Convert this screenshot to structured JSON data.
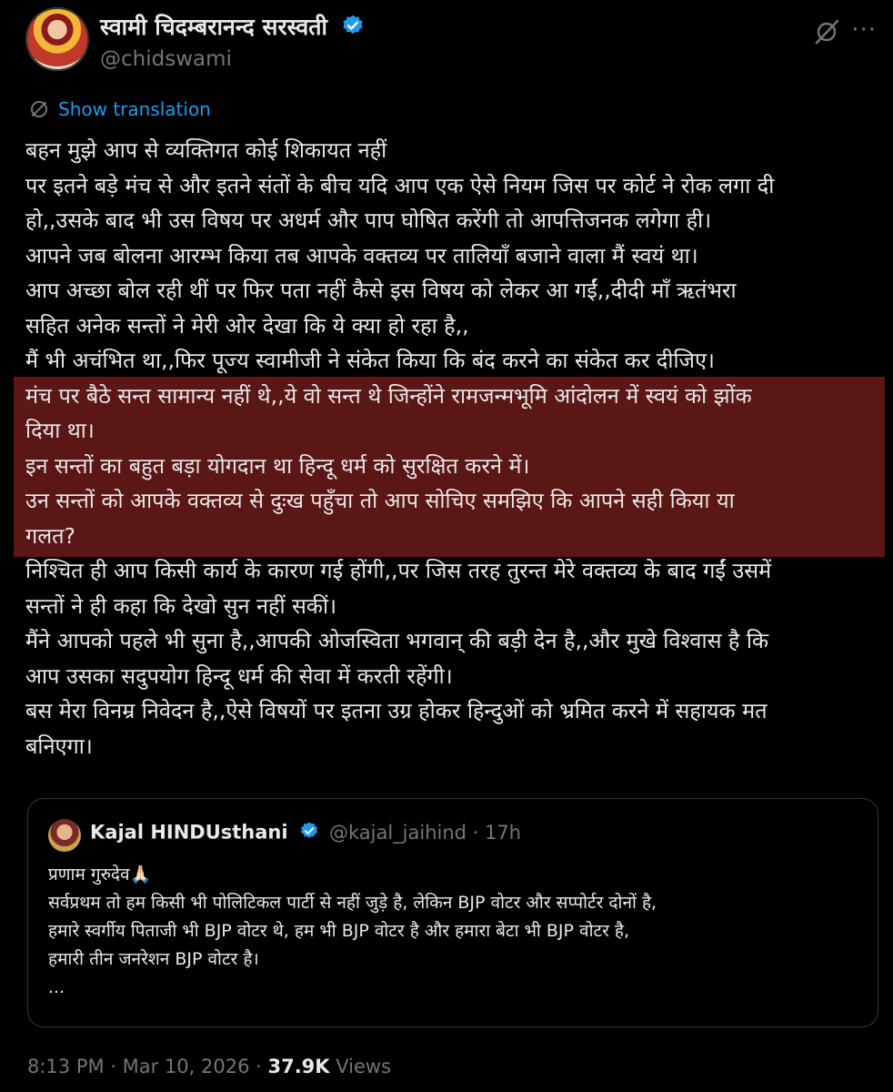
{
  "author": {
    "name": "स्वामी चिदम्बरानन्द सरस्वती",
    "handle": "@chidswami",
    "verified": true,
    "avatar_icon": "avatar"
  },
  "translate_label": "Show translation",
  "body_lines": [
    "बहन मुझे आप से व्यक्तिगत कोई शिकायत नहीं",
    "पर इतने बड़े मंच से और इतने संतों के बीच यदि आप एक ऐसे नियम जिस पर कोर्ट ने रोक लगा दी",
    "हो,,उसके बाद भी उस विषय पर अधर्म और पाप घोषित करेंगी तो आपत्तिजनक लगेगा ही।",
    "आपने जब बोलना आरम्भ किया तब आपके वक्तव्य पर तालियाँ बजाने वाला मैं स्वयं था।",
    "आप अच्छा बोल रही थीं पर फिर पता नहीं कैसे इस विषय को लेकर आ गईं,,दीदी माँ ऋतंभरा",
    "सहित अनेक सन्तों ने मेरी ओर देखा कि ये क्या हो रहा है,,",
    "मैं भी अचंभित था,,फिर पूज्य स्वामीजी ने संकेत किया कि बंद करने का संकेत कर दीजिए।",
    "मंच पर बैठे सन्त सामान्य नहीं थे,,ये वो सन्त थे जिन्होंने रामजन्मभूमि आंदोलन में स्वयं को झोंक",
    "दिया था।",
    "इन सन्तों का बहुत बड़ा योगदान था हिन्दू धर्म को सुरक्षित करने में।",
    "उन सन्तों को आपके वक्तव्य से दुःख पहुँचा तो आप सोचिए समझिए कि आपने सही किया या",
    "गलत?",
    "निश्चित ही आप किसी कार्य के कारण गई होंगी,,पर जिस तरह तुरन्त मेरे वक्तव्य के बाद गईं उसमें",
    "सन्तों ने ही कहा कि देखो सुन नहीं सकीं।",
    "मैंने आपको पहले भी सुना है,,आपकी ओजस्विता भगवान् की बड़ी देन है,,और मुखे विश्वास है कि",
    "आप उसका सदुपयोग हिन्दू धर्म की सेवा में करती रहेंगी।",
    "बस मेरा विनम्र निवेदन है,,ऐसे विषयों पर इतना उग्र होकर हिन्दुओं को भ्रमित करने में सहायक मत",
    "बनिएगा।"
  ],
  "quoted": {
    "name": "Kajal HINDUsthani",
    "handle_time": "@kajal_jaihind · 17h",
    "verified": true,
    "lines": [
      "प्रणाम गुरुदेव🙏🏻",
      "सर्वप्रथम तो हम किसी भी पोलिटिकल पार्टी से नहीं जुड़े है, लेकिन BJP वोटर और सप्पोर्टर दोनों है,",
      "हमारे स्वर्गीय पिताजी भी BJP वोटर थे, हम भी BJP वोटर है और हमारा बेटा भी BJP वोटर है,",
      "हमारी तीन जनरेशन BJP वोटर है।",
      "..."
    ]
  },
  "meta": {
    "time_date": "8:13 PM · Mar 10, 2026 · ",
    "views_count": "37.9K",
    "views_label": " Views"
  },
  "colors": {
    "background": "#000000",
    "text": "#e7e9ea",
    "muted": "#71767b",
    "link": "#1d9bf0",
    "highlight": "#6b1a1a",
    "verified": "#1d9bf0"
  }
}
